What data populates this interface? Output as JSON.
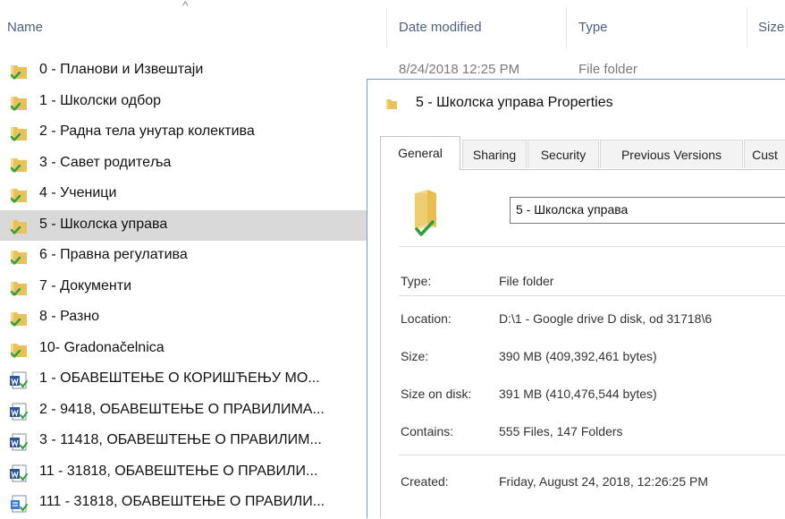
{
  "header": {
    "sort_arrow": "^",
    "col_name": "Name",
    "col_date": "Date modified",
    "col_type": "Type",
    "col_size": "Size"
  },
  "files": [
    {
      "name": "0 - Планови и Извештаји",
      "date": "8/24/2018 12:25 PM",
      "type": "File folder",
      "icon": "synced-folder-icon"
    },
    {
      "name": "1 - Школски одбор",
      "icon": "synced-folder-icon"
    },
    {
      "name": "2 - Радна тела унутар колектива",
      "icon": "synced-folder-icon"
    },
    {
      "name": "3 - Савет родитеља",
      "icon": "synced-folder-icon"
    },
    {
      "name": "4 - Ученици",
      "icon": "synced-folder-icon"
    },
    {
      "name": "5 - Школска управа",
      "icon": "synced-folder-icon",
      "selected": true
    },
    {
      "name": "6 - Правна регулатива",
      "icon": "synced-folder-icon"
    },
    {
      "name": "7 - Документи",
      "icon": "synced-folder-icon"
    },
    {
      "name": "8 - Разно",
      "icon": "synced-folder-icon"
    },
    {
      "name": "10- Gradonačelnica",
      "icon": "synced-folder-icon"
    },
    {
      "name": "1 - ОБАВЕШТЕЊЕ О КОРИШЋЕЊУ МО...",
      "icon": "word-doc-icon"
    },
    {
      "name": "2 - 9418, ОБАВЕШТЕЊЕ О ПРАВИЛИМА...",
      "icon": "word-doc-icon"
    },
    {
      "name": "3 - 11418, ОБАВЕШТЕЊЕ О ПРАВИЛИМ...",
      "icon": "word-doc-icon"
    },
    {
      "name": "11 - 31818, ОБАВЕШТЕЊЕ О ПРАВИЛИ...",
      "icon": "word-doc-icon"
    },
    {
      "name": "111 - 31818, ОБАВЕШТЕЊЕ О ПРАВИЛИ...",
      "icon": "doc-file-icon"
    }
  ],
  "dialog": {
    "title": "5 - Школска управа Properties",
    "tabs": [
      "General",
      "Sharing",
      "Security",
      "Previous Versions",
      "Cust"
    ],
    "active_tab": "General",
    "folder_name": "5 - Школска управа",
    "props": {
      "type_label": "Type:",
      "type_value": "File folder",
      "location_label": "Location:",
      "location_value": "D:\\1 - Google drive D disk, od 31718\\6",
      "size_label": "Size:",
      "size_value": "390 MB (409,392,461 bytes)",
      "size_on_disk_label": "Size on disk:",
      "size_on_disk_value": "391 MB (410,476,544 bytes)",
      "contains_label": "Contains:",
      "contains_value": "555 Files, 147 Folders",
      "created_label": "Created:",
      "created_value": "Friday, August 24, 2018, 12:26:25 PM"
    }
  },
  "colors": {
    "folder": "#e8c15a",
    "check": "#2f9e3e",
    "selection": "#d9d9d9",
    "header_text": "#4d6082"
  }
}
